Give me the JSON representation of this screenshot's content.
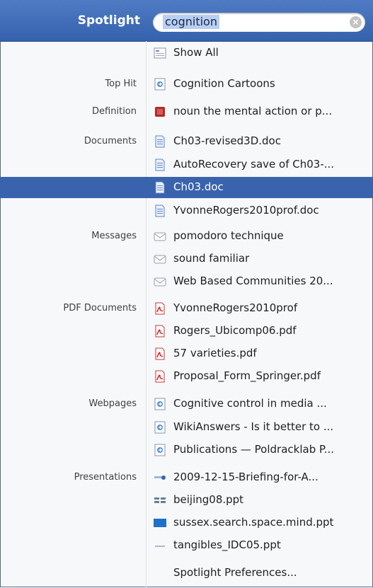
{
  "header": {
    "title": "Spotlight",
    "query": "cognition"
  },
  "rows": [
    {
      "category": "",
      "label": "Show All",
      "icon": "show-all",
      "selected": false
    },
    {
      "category": "Top Hit",
      "label": "Cognition Cartoons",
      "icon": "webpage",
      "selected": false
    },
    {
      "category": "Definition",
      "label": "noun  the mental action or p...",
      "icon": "dictionary",
      "selected": false
    },
    {
      "category": "Documents",
      "label": "Ch03-revised3D.doc",
      "icon": "doc",
      "selected": false
    },
    {
      "category": "",
      "label": "AutoRecovery save of Ch03-...",
      "icon": "doc",
      "selected": false
    },
    {
      "category": "",
      "label": "Ch03.doc",
      "icon": "doc",
      "selected": true
    },
    {
      "category": "",
      "label": "YvonneRogers2010prof.doc",
      "icon": "doc",
      "selected": false
    },
    {
      "category": "Messages",
      "label": "pomodoro technique",
      "icon": "mail",
      "selected": false
    },
    {
      "category": "",
      "label": "sound familiar",
      "icon": "mail",
      "selected": false
    },
    {
      "category": "",
      "label": "Web Based Communities 20...",
      "icon": "mail",
      "selected": false
    },
    {
      "category": "PDF Documents",
      "label": "YvonneRogers2010prof",
      "icon": "pdf",
      "selected": false
    },
    {
      "category": "",
      "label": "Rogers_Ubicomp06.pdf",
      "icon": "pdf",
      "selected": false
    },
    {
      "category": "",
      "label": "57 varieties.pdf",
      "icon": "pdf",
      "selected": false
    },
    {
      "category": "",
      "label": "Proposal_Form_Springer.pdf",
      "icon": "pdf",
      "selected": false
    },
    {
      "category": "Webpages",
      "label": "Cognitive control in media ...",
      "icon": "webpage",
      "selected": false
    },
    {
      "category": "",
      "label": "WikiAnswers - Is it better to ...",
      "icon": "webpage",
      "selected": false
    },
    {
      "category": "",
      "label": "Publications — Poldracklab P...",
      "icon": "webpage",
      "selected": false
    },
    {
      "category": "Presentations",
      "label": "2009-12-15-Briefing-for-A...",
      "icon": "slide-a",
      "selected": false
    },
    {
      "category": "",
      "label": "beijing08.ppt",
      "icon": "slide-b",
      "selected": false
    },
    {
      "category": "",
      "label": "sussex.search.space.mind.ppt",
      "icon": "slide-c",
      "selected": false
    },
    {
      "category": "",
      "label": "tangibles_IDC05.ppt",
      "icon": "slide-d",
      "selected": false
    },
    {
      "category": "",
      "label": "Spotlight Preferences...",
      "icon": "",
      "selected": false
    }
  ]
}
